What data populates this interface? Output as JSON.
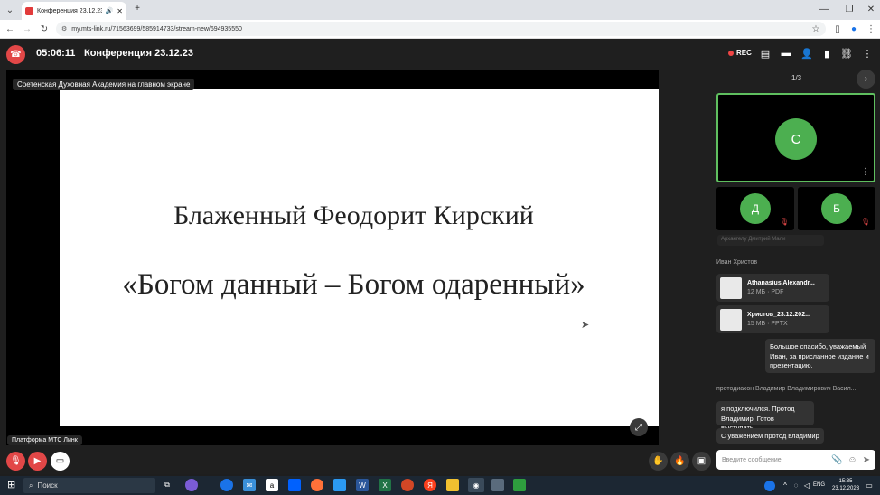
{
  "browser": {
    "tab_title": "Конференция 23.12.23 - …",
    "url": "my.mts-link.ru/71563699/585914733/stream-new/694935550"
  },
  "header": {
    "timer": "05:06:11",
    "title": "Конференция 23.12.23",
    "rec_label": "REC"
  },
  "stage": {
    "screen_label": "Сретенская Духовная Академия на главном экране",
    "platform_label": "Платформа МТС Линк",
    "slide_title": "Блаженный Феодорит Кирский",
    "slide_subtitle": "«Богом данный – Богом одаренный»"
  },
  "participants": {
    "page_indicator": "1/3",
    "main_initial": "С",
    "tiles": [
      {
        "initial": "Д"
      },
      {
        "initial": "Б"
      }
    ]
  },
  "chat": {
    "faded_message": "Архангелу Дмитрий Мали",
    "sender1": "Иван Христов",
    "files": [
      {
        "name": "Athanasius Alexandr...",
        "meta": "12 МБ · PDF"
      },
      {
        "name": "Христов_23.12.202...",
        "meta": "15 МБ · PPTX"
      }
    ],
    "msg1": "Большое спасибо, уважаемый Иван, за присланное издание и презентацию.",
    "sender2": "протодиакон Владимир Владимирович Васил...",
    "msg2": "я подключился. Протод Владимир. Готов выступать.",
    "msg3": "С уважением протод владимир",
    "input_placeholder": "Введите сообщение"
  },
  "taskbar": {
    "search_label": "Поиск",
    "lang": "ENG",
    "time": "15:35",
    "date": "23.12.2023"
  },
  "colors": {
    "end_call": "#e24747",
    "avatar": "#4caf50",
    "active_border": "#5fbf5f"
  }
}
